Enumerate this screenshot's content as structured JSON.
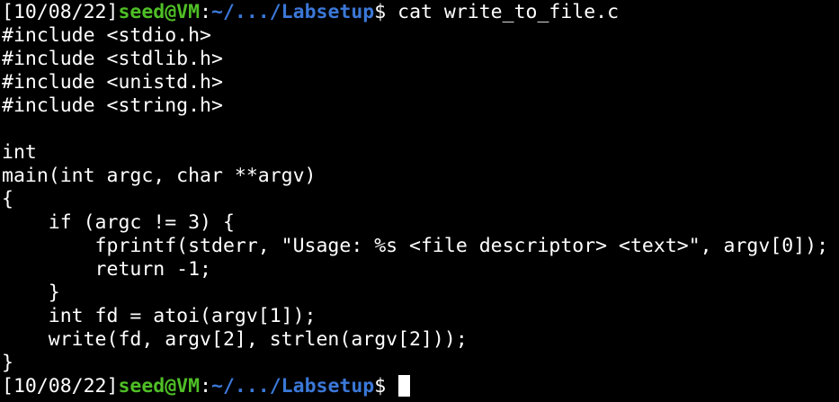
{
  "colors": {
    "background": "#000000",
    "text": "#ffffff",
    "host": "#4fbf26",
    "path": "#3b78d8"
  },
  "prompt": {
    "timestamp": "[10/08/22]",
    "user_host": "seed@VM",
    "separator": ":",
    "path": "~/.../Labsetup",
    "symbol": "$ "
  },
  "command": "cat write_to_file.c",
  "output_lines": [
    "#include <stdio.h>",
    "#include <stdlib.h>",
    "#include <unistd.h>",
    "#include <string.h>",
    "",
    "int",
    "main(int argc, char **argv)",
    "{",
    "    if (argc != 3) {",
    "        fprintf(stderr, \"Usage: %s <file descriptor> <text>\", argv[0]);",
    "        return -1;",
    "    }",
    "    int fd = atoi(argv[1]);",
    "    write(fd, argv[2], strlen(argv[2]));",
    "}"
  ]
}
